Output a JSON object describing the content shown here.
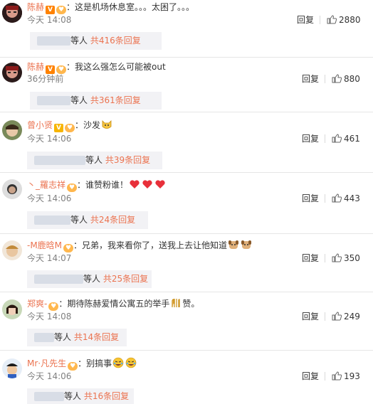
{
  "comments": [
    {
      "user": "陈赫",
      "text": "：这是机场休息室。。。太困了。。。",
      "time": "今天 14:08",
      "reply": "回复",
      "likes": "2880",
      "sub_suffix": "等人",
      "sub_count": "共416条回复"
    },
    {
      "user": "陈赫",
      "text": "：我这么强怎么可能被out",
      "time": "36分钟前",
      "reply": "回复",
      "likes": "880",
      "sub_suffix": "等人",
      "sub_count": "共361条回复"
    },
    {
      "user": "曾小贤",
      "text": "：沙发",
      "time": "今天 14:06",
      "reply": "回复",
      "likes": "461",
      "sub_suffix": "等人",
      "sub_count": "共39条回复"
    },
    {
      "user": "丶_羅志祥",
      "text": "：谁赞粉谁！",
      "time": "今天 14:06",
      "reply": "回复",
      "likes": "443",
      "sub_suffix": "等人",
      "sub_count": "共24条回复"
    },
    {
      "user": "-M鹿晗M",
      "text": "：兄弟，我来看你了，送我上去让他知道",
      "time": "今天 14:07",
      "reply": "回复",
      "likes": "350",
      "sub_suffix": "等人",
      "sub_count": "共25条回复"
    },
    {
      "user": "郑爽-",
      "text": "：期待陈赫爱情公寓五的举手",
      "text_tail": "赞。",
      "time": "今天 14:08",
      "reply": "回复",
      "likes": "249",
      "sub_suffix": "等人",
      "sub_count": "共14条回复"
    },
    {
      "user": "Mr·凡先生",
      "text": "：别搞事",
      "time": "今天 14:06",
      "reply": "回复",
      "likes": "193",
      "sub_suffix": "等人",
      "sub_count": "共16条回复"
    }
  ],
  "colors": {
    "username": "#eb7350",
    "time": "#808080",
    "subbox_bg": "#f2f2f5",
    "divider": "#e6e6e6"
  },
  "icons": [
    "avatar",
    "vip-badge-icon",
    "fan-badge-icon",
    "thumb-up-icon",
    "heart-emoji-icon",
    "cat-emoji-icon",
    "dog-emoji-icon",
    "clap-emoji-icon",
    "cry-laugh-emoji-icon"
  ]
}
